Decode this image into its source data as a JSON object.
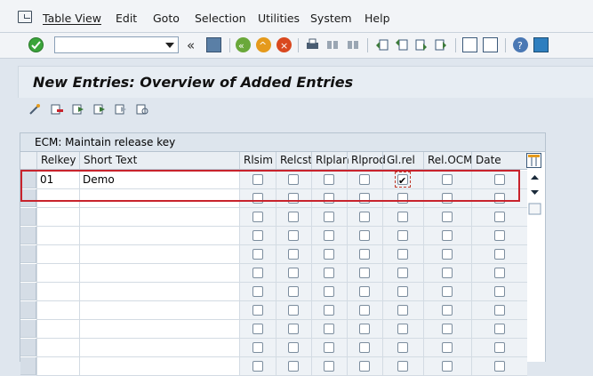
{
  "menu": {
    "items": [
      "Table View",
      "Edit",
      "Goto",
      "Selection",
      "Utilities",
      "System",
      "Help"
    ]
  },
  "toolbar": {
    "command_value": "",
    "icons": [
      "enter-icon",
      "save-icon",
      "back-icon",
      "exit-icon",
      "cancel-icon",
      "print-icon",
      "find-icon",
      "find-next-icon",
      "first-page-icon",
      "previous-page-icon",
      "next-page-icon",
      "last-page-icon",
      "create-session-icon",
      "shortcut-icon",
      "help-icon",
      "customize-layout-icon"
    ]
  },
  "title": "New Entries: Overview of Added Entries",
  "table": {
    "caption": "ECM: Maintain release key",
    "columns": [
      "Relkey",
      "Short Text",
      "Rlsim",
      "Relcst",
      "Rlplan",
      "Rlprod",
      "Gl.rel",
      "Rel.OCM",
      "Date OCM"
    ],
    "rows": [
      {
        "relkey": "01",
        "short_text": "Demo",
        "flags": [
          false,
          false,
          false,
          false,
          true,
          false,
          false
        ]
      },
      {
        "relkey": "",
        "short_text": "",
        "flags": [
          false,
          false,
          false,
          false,
          false,
          false,
          false
        ]
      },
      {
        "relkey": "",
        "short_text": "",
        "flags": [
          false,
          false,
          false,
          false,
          false,
          false,
          false
        ]
      },
      {
        "relkey": "",
        "short_text": "",
        "flags": [
          false,
          false,
          false,
          false,
          false,
          false,
          false
        ]
      },
      {
        "relkey": "",
        "short_text": "",
        "flags": [
          false,
          false,
          false,
          false,
          false,
          false,
          false
        ]
      },
      {
        "relkey": "",
        "short_text": "",
        "flags": [
          false,
          false,
          false,
          false,
          false,
          false,
          false
        ]
      },
      {
        "relkey": "",
        "short_text": "",
        "flags": [
          false,
          false,
          false,
          false,
          false,
          false,
          false
        ]
      },
      {
        "relkey": "",
        "short_text": "",
        "flags": [
          false,
          false,
          false,
          false,
          false,
          false,
          false
        ]
      },
      {
        "relkey": "",
        "short_text": "",
        "flags": [
          false,
          false,
          false,
          false,
          false,
          false,
          false
        ]
      },
      {
        "relkey": "",
        "short_text": "",
        "flags": [
          false,
          false,
          false,
          false,
          false,
          false,
          false
        ]
      },
      {
        "relkey": "",
        "short_text": "",
        "flags": [
          false,
          false,
          false,
          false,
          false,
          false,
          false
        ]
      }
    ]
  },
  "colors": {
    "highlight": "#c8232c",
    "background": "#dfe6ee"
  }
}
